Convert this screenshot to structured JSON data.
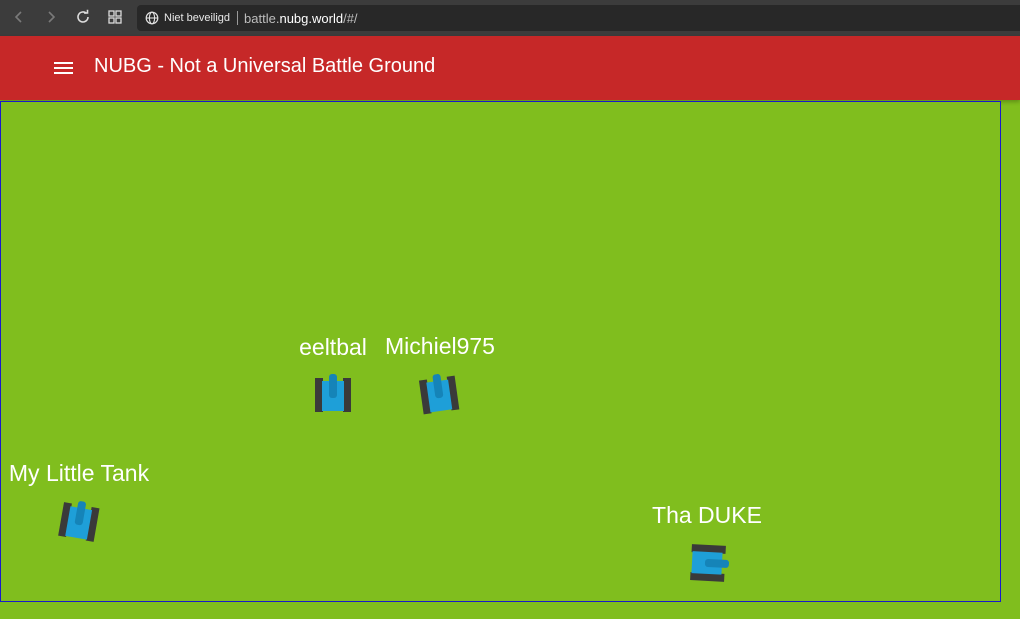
{
  "browser": {
    "security_label": "Niet beveiligd",
    "url_prefix": "battle.",
    "url_domain": "nubg.world",
    "url_path": "/#/",
    "icons": [
      "back-icon",
      "forward-icon",
      "reload-icon",
      "tabs-grid-icon",
      "globe-icon"
    ]
  },
  "app_bar": {
    "title": "NUBG - Not a Universal Battle Ground",
    "color": "#c62828"
  },
  "game": {
    "background_color": "#80be1e",
    "border_color": "#1a1acc",
    "tank_body_color": "#1e9fd8",
    "tank_track_color": "#3a3a3a",
    "players": [
      {
        "name": "eeltbal"
      },
      {
        "name": "Michiel975"
      },
      {
        "name": "My Little Tank"
      },
      {
        "name": "Tha DUKE"
      }
    ]
  }
}
